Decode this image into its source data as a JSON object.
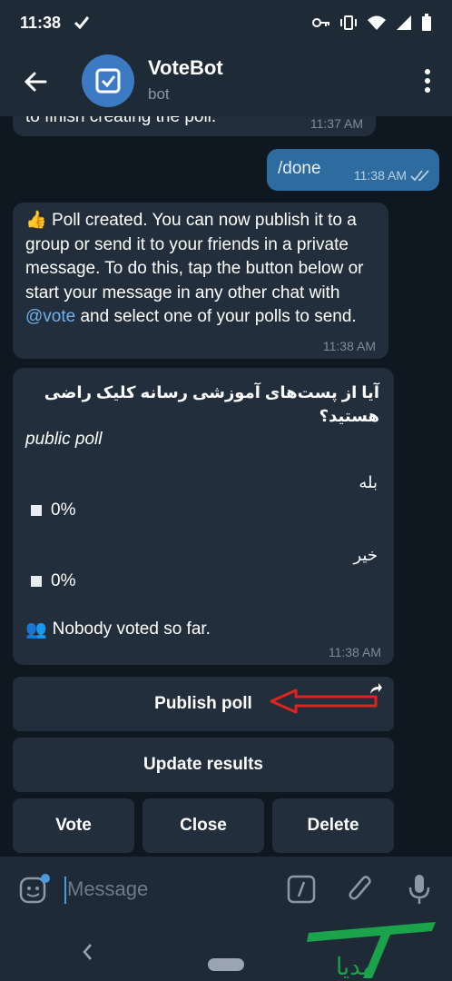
{
  "status_bar": {
    "time": "11:38"
  },
  "app_bar": {
    "title": "VoteBot",
    "subtitle": "bot"
  },
  "messages": {
    "previous": {
      "text": "to finish creating the poll.",
      "time": "11:37 AM"
    },
    "outgoing": {
      "text": "/done",
      "time": "11:38 AM"
    },
    "created": {
      "emoji": "👍",
      "text_before_link": " Poll created. You can now publish it to a group or send it to your friends in a private message. To do this, tap the button below or start your message in any other chat with ",
      "link": "@vote",
      "text_after_link": " and select one of your polls to send.",
      "time": "11:38 AM"
    },
    "poll": {
      "question": "آیا از پست‌های آموزشی رسانه کلیک راضی هستید؟",
      "kind": "public poll",
      "options": [
        {
          "label": "بله",
          "percent": "0%"
        },
        {
          "label": "خیر",
          "percent": "0%"
        }
      ],
      "status_emoji": "👥",
      "status": "Nobody voted so far.",
      "time": "11:38 AM"
    }
  },
  "keyboard": {
    "publish": "Publish poll",
    "update": "Update results",
    "vote": "Vote",
    "close": "Close",
    "delete": "Delete"
  },
  "input": {
    "placeholder": "Message"
  },
  "watermark": {
    "text": "مدیا"
  },
  "colors": {
    "background": "#0f1720",
    "bubble": "#222e3b",
    "outgoing_bubble": "#2e6c9f",
    "link": "#6fb2ee",
    "annotation_arrow": "#e0231e"
  }
}
